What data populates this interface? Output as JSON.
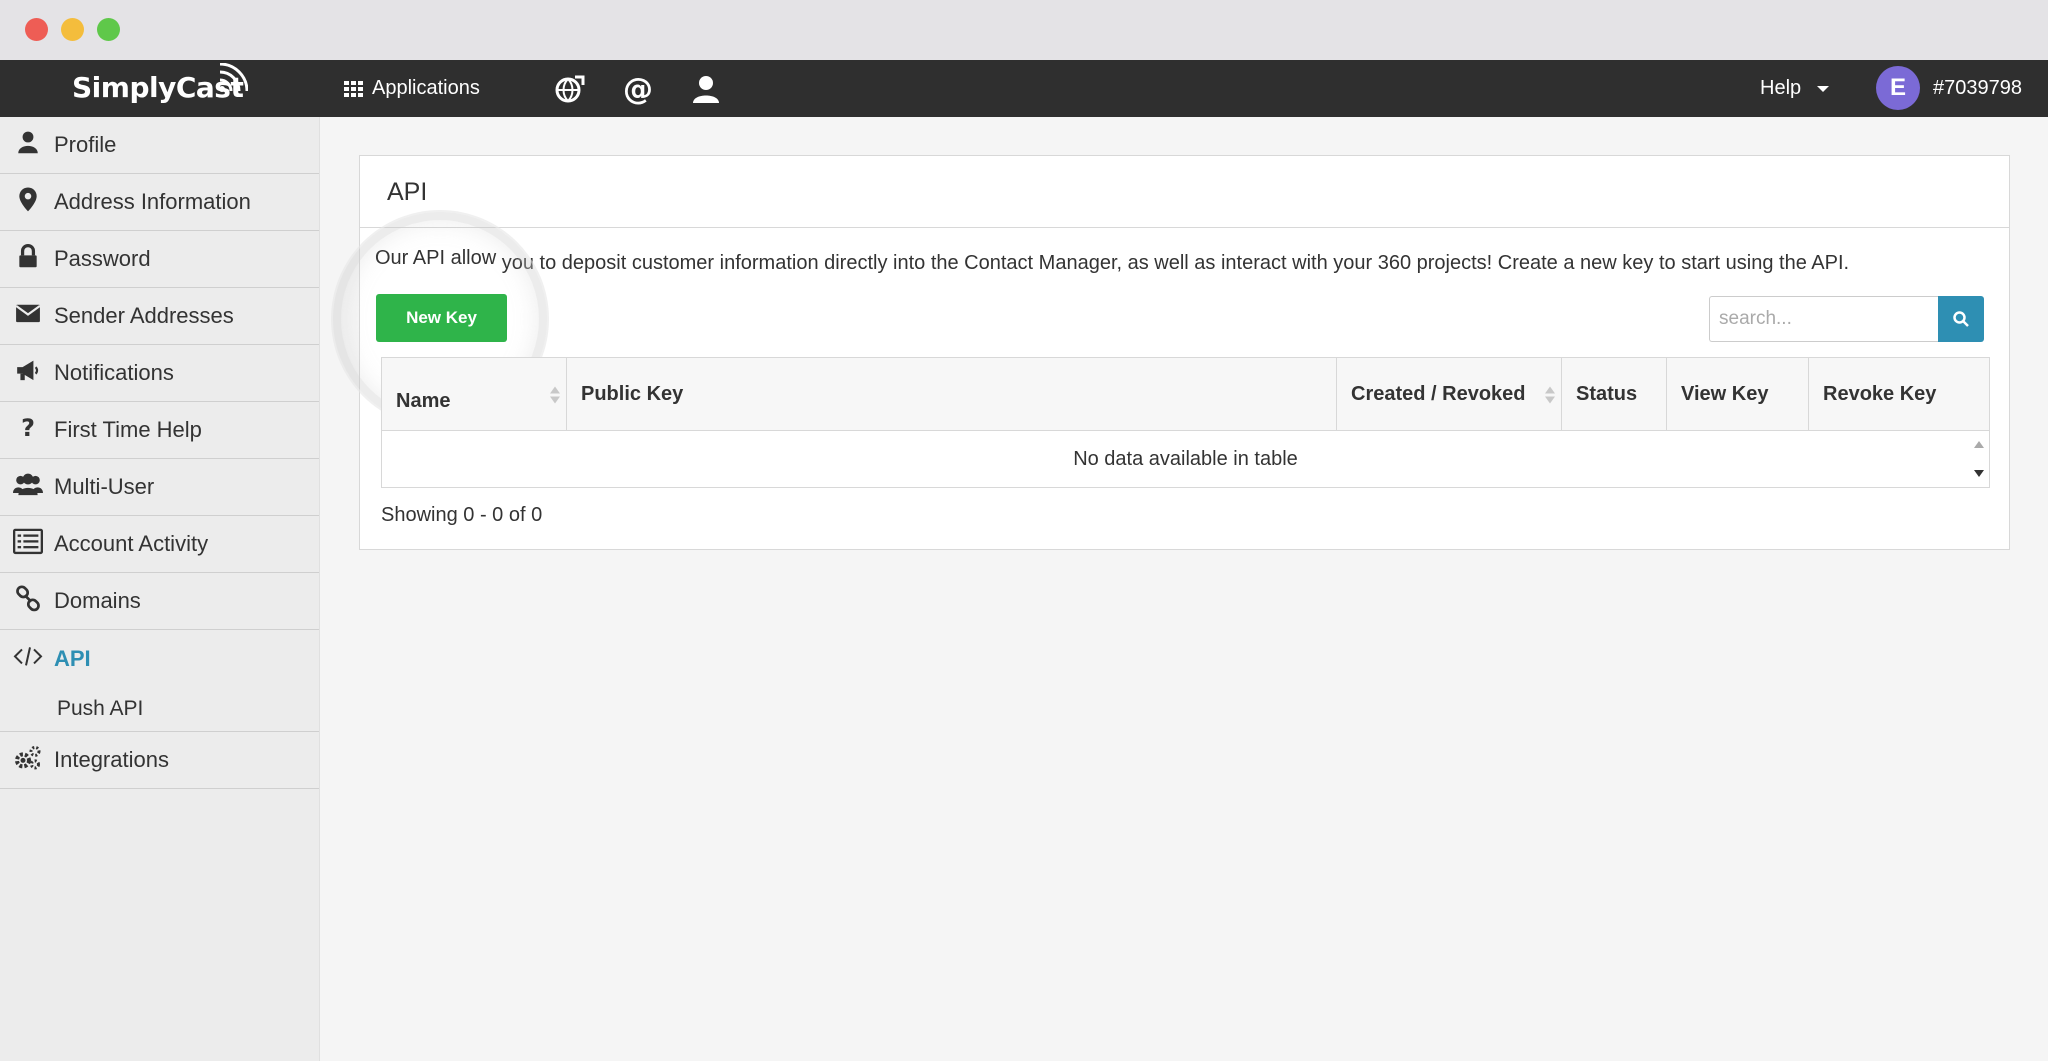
{
  "brand": {
    "name": "SimplyCast"
  },
  "topnav": {
    "applications_label": "Applications",
    "icons": [
      "globe-icon",
      "at-icon",
      "user-icon"
    ],
    "help_label": "Help",
    "avatar_initial": "E",
    "account_id": "#7039798"
  },
  "sidebar": {
    "items": [
      {
        "label": "Profile",
        "icon": "user-icon"
      },
      {
        "label": "Address Information",
        "icon": "map-marker-icon"
      },
      {
        "label": "Password",
        "icon": "lock-icon"
      },
      {
        "label": "Sender Addresses",
        "icon": "envelope-icon"
      },
      {
        "label": "Notifications",
        "icon": "megaphone-icon"
      },
      {
        "label": "First Time Help",
        "icon": "question-icon"
      },
      {
        "label": "Multi-User",
        "icon": "users-icon"
      },
      {
        "label": "Account Activity",
        "icon": "list-icon"
      },
      {
        "label": "Domains",
        "icon": "link-icon"
      },
      {
        "label": "API",
        "icon": "code-icon",
        "active": true
      },
      {
        "label": "Push API",
        "sub": true
      },
      {
        "label": "Integrations",
        "icon": "gears-icon"
      }
    ]
  },
  "main": {
    "panel_title": "API",
    "description_a": "Our API allow",
    "description_b": "you to deposit customer information directly into the Contact Manager, as well as interact with your 360 projects! Create a new key to start using the API.",
    "new_key_label": "New Key",
    "search_placeholder": "search...",
    "table": {
      "columns": [
        "Name",
        "Public Key",
        "Created / Revoked",
        "Status",
        "View Key",
        "Revoke Key"
      ],
      "empty_message": "No data available in table"
    },
    "showing_text": "Showing 0 - 0 of 0"
  },
  "colors": {
    "accent": "#2e8fb3",
    "new_key_button": "#2fb44a",
    "topnav_bg": "#2f2f2f",
    "avatar_bg": "#7b6ad6"
  }
}
